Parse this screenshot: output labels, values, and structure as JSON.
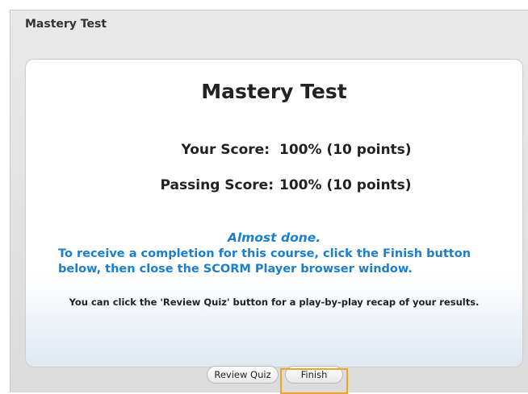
{
  "window": {
    "title": "Mastery Test"
  },
  "panel": {
    "title": "Mastery Test",
    "your_score_label": "Your Score:",
    "your_score_value": "100% (10 points)",
    "passing_score_label": "Passing Score:",
    "passing_score_value": "100% (10 points)",
    "almost_done": "Almost done.",
    "completion_line1": "To receive a completion for this course, click the Finish button",
    "completion_line2": "below, then close the SCORM Player browser window.",
    "review_hint": "You can click the 'Review Quiz' button for a play-by-play recap of your results."
  },
  "buttons": {
    "review_quiz": "Review Quiz",
    "finish": "Finish"
  },
  "colors": {
    "accent_text": "#1a7fd1",
    "focus_ring": "#f0a623"
  }
}
